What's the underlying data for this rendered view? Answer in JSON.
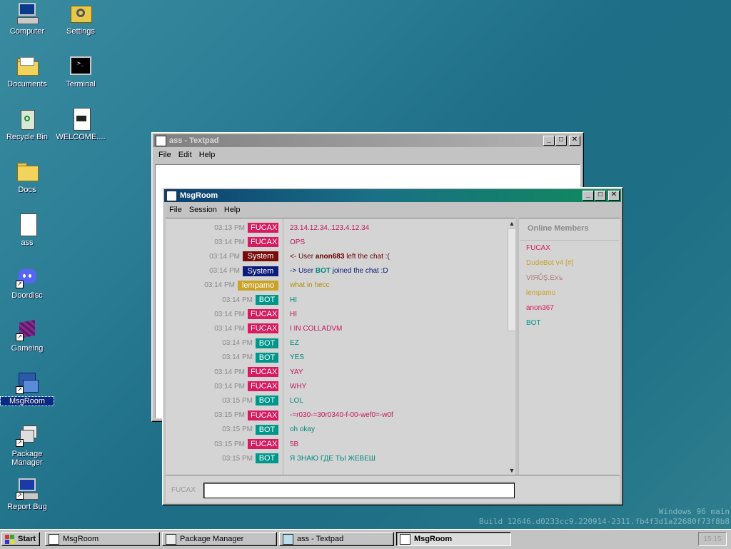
{
  "desktop": {
    "icons": [
      {
        "label": "Computer"
      },
      {
        "label": "Settings"
      },
      {
        "label": "Documents"
      },
      {
        "label": "Terminal"
      },
      {
        "label": "Recycle Bin"
      },
      {
        "label": "WELCOME...."
      },
      {
        "label": "Docs"
      },
      {
        "label": "ass"
      },
      {
        "label": "Doordisc"
      },
      {
        "label": "Gameing"
      },
      {
        "label": "MsgRoom"
      },
      {
        "label": "Package Manager"
      },
      {
        "label": "Report Bug"
      }
    ]
  },
  "textpad": {
    "title": "ass - Textpad",
    "menu": [
      "File",
      "Edit",
      "Help"
    ]
  },
  "msgroom": {
    "title": "MsgRoom",
    "menu": [
      "File",
      "Session",
      "Help"
    ],
    "messages": [
      {
        "time": "03:13 PM",
        "name": "FUCAX",
        "name_color": "#d81b60",
        "text": "23.14.12.34..123.4.12.34",
        "text_color": "#c2185b"
      },
      {
        "time": "03:14 PM",
        "name": "FUCAX",
        "name_color": "#d81b60",
        "text": "OPS",
        "text_color": "#c2185b"
      },
      {
        "time": "03:14 PM",
        "name": "System",
        "name_color": "#7a0b0b",
        "text_pre": "<- User ",
        "text_bold": "anon683",
        "text_post": " left the chat :(",
        "text_color": "#6a0000"
      },
      {
        "time": "03:14 PM",
        "name": "System",
        "name_color": "#0b1c7a",
        "text_pre": "-> User ",
        "text_bold": "BOT",
        "text_bold_color": "#00897b",
        "text_post": " joined the chat :D",
        "text_color": "#0b1c7a"
      },
      {
        "time": "03:14 PM",
        "name": "lempamo",
        "name_color": "#c9a227",
        "text": "what in hecc",
        "text_color": "#b38f00"
      },
      {
        "time": "03:14 PM",
        "name": "BOT",
        "name_color": "#00968a",
        "text": "HI",
        "text_color": "#00897b"
      },
      {
        "time": "03:14 PM",
        "name": "FUCAX",
        "name_color": "#d81b60",
        "text": "HI",
        "text_color": "#c2185b"
      },
      {
        "time": "03:14 PM",
        "name": "FUCAX",
        "name_color": "#d81b60",
        "text": "I IN COLLADVM",
        "text_color": "#c2185b"
      },
      {
        "time": "03:14 PM",
        "name": "BOT",
        "name_color": "#00968a",
        "text": "EZ",
        "text_color": "#00897b"
      },
      {
        "time": "03:14 PM",
        "name": "BOT",
        "name_color": "#00968a",
        "text": "YES",
        "text_color": "#00897b"
      },
      {
        "time": "03:14 PM",
        "name": "FUCAX",
        "name_color": "#d81b60",
        "text": "YAY",
        "text_color": "#c2185b"
      },
      {
        "time": "03:14 PM",
        "name": "FUCAX",
        "name_color": "#d81b60",
        "text": "WHY",
        "text_color": "#c2185b"
      },
      {
        "time": "03:15 PM",
        "name": "BOT",
        "name_color": "#00968a",
        "text": "LOL",
        "text_color": "#00897b"
      },
      {
        "time": "03:15 PM",
        "name": "FUCAX",
        "name_color": "#d81b60",
        "text": "-=r030-=30r0340-f-00-wef0=-w0f",
        "text_color": "#c2185b"
      },
      {
        "time": "03:15 PM",
        "name": "BOT",
        "name_color": "#00968a",
        "text": "oh okay",
        "text_color": "#00897b"
      },
      {
        "time": "03:15 PM",
        "name": "FUCAX",
        "name_color": "#d81b60",
        "text": "5B",
        "text_color": "#c2185b"
      },
      {
        "time": "03:15 PM",
        "name": "BOT",
        "name_color": "#00968a",
        "text": "Я ЗНАЮ ГДЕ ТЫ ЖЕВЕШ",
        "text_color": "#00897b"
      }
    ],
    "members_header": "Online Members",
    "members": [
      {
        "name": "FUCAX",
        "color": "#d81b60"
      },
      {
        "name": "DudeBot v4 [#]",
        "color": "#c9a227"
      },
      {
        "name": "VΙЯŮŞ.Exъ",
        "color": "#b37a7a"
      },
      {
        "name": "lempamo",
        "color": "#c9a227"
      },
      {
        "name": "anon367",
        "color": "#d81b60"
      },
      {
        "name": "BOT",
        "color": "#00968a"
      }
    ],
    "input_nick": "FUCAX",
    "input_value": ""
  },
  "watermark": {
    "line1": "Windows 96 main",
    "line2": "Build 12646.d0233cc9.220914-2311.fb4f3d1a22680f73f8b8"
  },
  "taskbar": {
    "start_label": "Start",
    "tasks": [
      {
        "label": "MsgRoom",
        "active": false
      },
      {
        "label": "Package Manager",
        "active": false
      },
      {
        "label": "ass - Textpad",
        "active": false
      },
      {
        "label": "MsgRoom",
        "active": true
      }
    ],
    "clock": "15:15"
  }
}
